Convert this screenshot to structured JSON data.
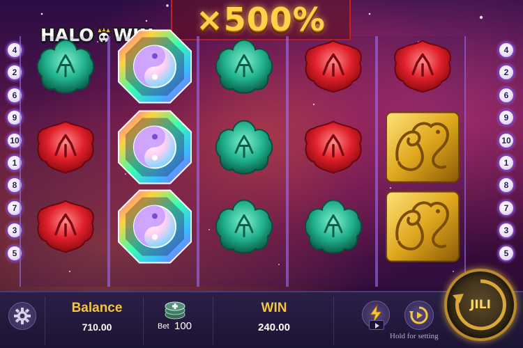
{
  "game": {
    "multiplier_text": "×500%",
    "logo": {
      "left": "HALO",
      "right": "WIN",
      "crown_icon": "crown-skull-icon"
    }
  },
  "paylines": {
    "left": [
      "4",
      "2",
      "6",
      "9",
      "10",
      "1",
      "8",
      "7",
      "3",
      "5"
    ],
    "right": [
      "4",
      "2",
      "6",
      "9",
      "10",
      "1",
      "8",
      "7",
      "3",
      "5"
    ]
  },
  "reels": [
    [
      "green-lotus",
      "red-gem",
      "red-gem"
    ],
    [
      "yin-yang",
      "yin-yang",
      "yin-yang"
    ],
    [
      "green-lotus",
      "green-lotus",
      "green-lotus"
    ],
    [
      "red-gem",
      "red-gem",
      "green-lotus"
    ],
    [
      "red-gem",
      "gold-dragon",
      "gold-dragon"
    ]
  ],
  "bottom_bar": {
    "settings_icon": "gear-icon",
    "balance_label": "Balance",
    "balance_value": "710.00",
    "bet_icon": "chip-stack-icon",
    "bet_label": "Bet",
    "bet_value": "100",
    "win_label": "WIN",
    "win_value": "240.00",
    "turbo_icon": "lightning-icon",
    "autospin_icon": "autospin-icon",
    "hold_text": "Hold for setting",
    "spin_label": "JILI"
  },
  "colors": {
    "gold": "#f2c640",
    "red_frame": "#c8201e",
    "payline_border": "#7a3fb8",
    "bar_bg": "#2b1f47"
  }
}
